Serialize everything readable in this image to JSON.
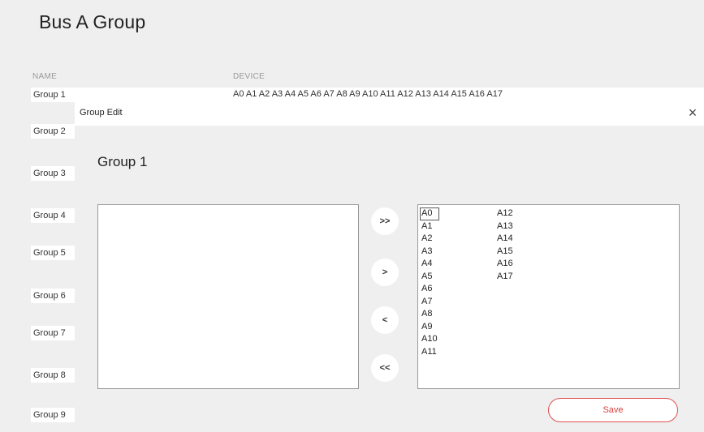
{
  "header": {
    "title": "Bus A  Group"
  },
  "columns": {
    "name": "NAME",
    "device": "DEVICE"
  },
  "groups": [
    {
      "label": "Group 1",
      "devices": "A0 A1 A2 A3 A4 A5 A6 A7 A8 A9 A10 A11 A12 A13 A14 A15 A16 A17"
    },
    {
      "label": "Group 2"
    },
    {
      "label": "Group 3"
    },
    {
      "label": "Group 4"
    },
    {
      "label": "Group 5"
    },
    {
      "label": "Group 6"
    },
    {
      "label": "Group 7"
    },
    {
      "label": "Group 8"
    },
    {
      "label": "Group 9"
    }
  ],
  "dialog": {
    "title": "Group Edit",
    "close_label": "×",
    "heading": "Group 1",
    "available_items": [],
    "selected_items": [
      "A0",
      "A1",
      "A2",
      "A3",
      "A4",
      "A5",
      "A6",
      "A7",
      "A8",
      "A9",
      "A10",
      "A11",
      "A12",
      "A13",
      "A14",
      "A15",
      "A16",
      "A17"
    ],
    "selected_highlight": "A0",
    "buttons": {
      "add_all": ">>",
      "add": ">",
      "remove": "<",
      "remove_all": "<<",
      "save": "Save"
    }
  },
  "colors": {
    "accent": "#d9413f",
    "background": "#efefef"
  }
}
